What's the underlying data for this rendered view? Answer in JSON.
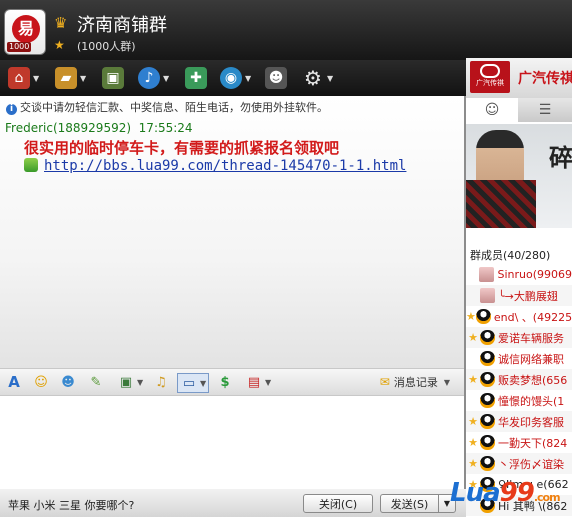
{
  "window": {
    "group_name": "济南商铺群",
    "group_count": "(1000人群)",
    "logo_text": "1000"
  },
  "toolbar": {
    "items": [
      "home-icon",
      "folder-icon",
      "album-icon",
      "voice-icon",
      "apps-icon",
      "video-icon",
      "user-icon",
      "settings-icon"
    ]
  },
  "ad": {
    "text": "广汽传祺",
    "brand_small": "广汽传祺"
  },
  "chat": {
    "notice": "交谈中请勿轻信汇款、中奖信息、陌生电话，勿使用外挂软件。",
    "messages": [
      {
        "sender": "Frederic(188929592)",
        "time": "17:55:24",
        "text": "很实用的临时停车卡，有需要的抓紧报名领取吧",
        "link": "http://bbs.lua99.com/thread-145470-1-1.html"
      }
    ]
  },
  "format_bar": {
    "history_label": "消息记录"
  },
  "bottom": {
    "ticker": "苹果 小米 三星 你要哪个?",
    "close_label": "关闭(C)",
    "send_label": "发送(S)"
  },
  "right_panel": {
    "banner_char": "碎",
    "members_header": "群成员(40/280)",
    "members": [
      {
        "star": false,
        "name": "Sinruo(99069",
        "color": "red"
      },
      {
        "star": false,
        "name": "╰→大鹏展翅",
        "color": "red"
      },
      {
        "star": true,
        "name": "end\\ 、(49225",
        "color": "red"
      },
      {
        "star": true,
        "name": "爱诺车辆服务",
        "color": "red"
      },
      {
        "star": false,
        "name": "诚信网络兼职",
        "color": "red"
      },
      {
        "star": true,
        "name": "贩卖梦想(656",
        "color": "red"
      },
      {
        "star": false,
        "name": "憧憬的馒头(1",
        "color": "red"
      },
      {
        "star": true,
        "name": "华发印务客服",
        "color": "red"
      },
      {
        "star": true,
        "name": "一勤天下(824",
        "color": "red"
      },
      {
        "star": true,
        "name": "丶浮伤〆谊染",
        "color": "red"
      },
      {
        "star": true,
        "name": "♀I'm ч e(662",
        "color": "dark"
      },
      {
        "star": false,
        "name": "Hi 其鸭 \\(862",
        "color": "dark"
      }
    ]
  },
  "watermark": {
    "brand_a": "Lua",
    "brand_b": "99",
    "suffix": ".com"
  }
}
